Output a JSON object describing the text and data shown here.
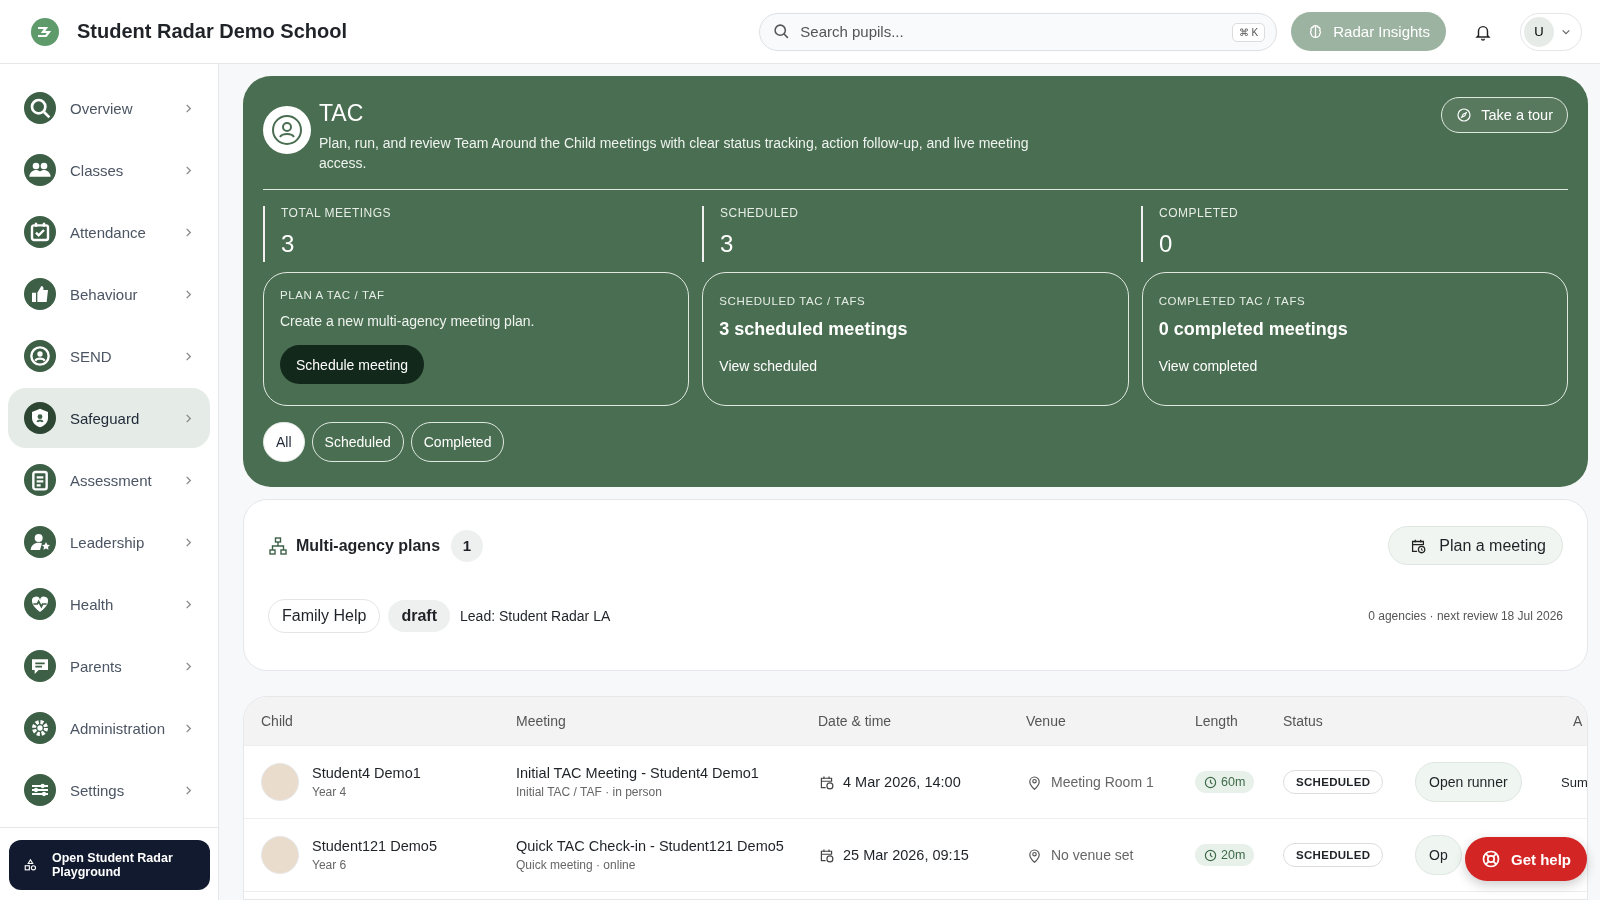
{
  "header": {
    "school_name": "Student Radar Demo School",
    "search": {
      "placeholder": "Search pupils...",
      "shortcut": "⌘ K"
    },
    "insights_button": "Radar Insights",
    "user_initial": "U"
  },
  "sidebar": {
    "items": [
      {
        "label": "Overview",
        "selected": false
      },
      {
        "label": "Classes",
        "selected": false
      },
      {
        "label": "Attendance",
        "selected": false
      },
      {
        "label": "Behaviour",
        "selected": false
      },
      {
        "label": "SEND",
        "selected": false
      },
      {
        "label": "Safeguard",
        "selected": true
      },
      {
        "label": "Assessment",
        "selected": false
      },
      {
        "label": "Leadership",
        "selected": false
      },
      {
        "label": "Health",
        "selected": false
      },
      {
        "label": "Parents",
        "selected": false
      },
      {
        "label": "Administration",
        "selected": false
      },
      {
        "label": "Settings",
        "selected": false
      }
    ],
    "playground_button": "Open Student Radar Playground"
  },
  "hero": {
    "title": "TAC",
    "description": "Plan, run, and review Team Around the Child meetings with clear status tracking, action follow-up, and live meeting access.",
    "tour_button": "Take a tour",
    "stats": [
      {
        "label": "TOTAL MEETINGS",
        "value": "3"
      },
      {
        "label": "SCHEDULED",
        "value": "3"
      },
      {
        "label": "COMPLETED",
        "value": "0"
      }
    ],
    "cards": [
      {
        "kind": "action",
        "eyebrow": "PLAN A TAC / TAF",
        "text": "Create a new multi-agency meeting plan.",
        "button": "Schedule meeting"
      },
      {
        "kind": "summary",
        "eyebrow": "SCHEDULED TAC / TAFS",
        "headline": "3 scheduled meetings",
        "link": "View scheduled"
      },
      {
        "kind": "summary",
        "eyebrow": "COMPLETED TAC / TAFS",
        "headline": "0 completed meetings",
        "link": "View completed"
      }
    ],
    "filters": [
      {
        "label": "All",
        "selected": true
      },
      {
        "label": "Scheduled",
        "selected": false
      },
      {
        "label": "Completed",
        "selected": false
      }
    ]
  },
  "plans": {
    "title": "Multi-agency plans",
    "count": "1",
    "button": "Plan a meeting",
    "items": [
      {
        "name": "Family Help",
        "status": "draft",
        "lead": "Lead: Student Radar LA",
        "meta": "0 agencies · next review 18 Jul 2026"
      }
    ]
  },
  "table": {
    "columns": [
      "Child",
      "Meeting",
      "Date & time",
      "Venue",
      "Length",
      "Status"
    ],
    "column_8": "A",
    "rows": [
      {
        "child": "Student4 Demo1",
        "year": "Year 4",
        "meeting": "Initial TAC Meeting - Student4 Demo1",
        "meeting_detail": "Initial TAC / TAF · in person",
        "date": "4 Mar 2026, 14:00",
        "venue": "Meeting Room 1",
        "length": "60m",
        "status": "SCHEDULED",
        "action": "Open runner",
        "column_8": "Sum"
      },
      {
        "child": "Student121 Demo5",
        "year": "Year 6",
        "meeting": "Quick TAC Check-in - Student121 Demo5",
        "meeting_detail": "Quick meeting · online",
        "date": "25 Mar 2026, 09:15",
        "venue": "No venue set",
        "length": "20m",
        "status": "SCHEDULED",
        "action": "Op"
      }
    ]
  },
  "help_button": "Get help"
}
